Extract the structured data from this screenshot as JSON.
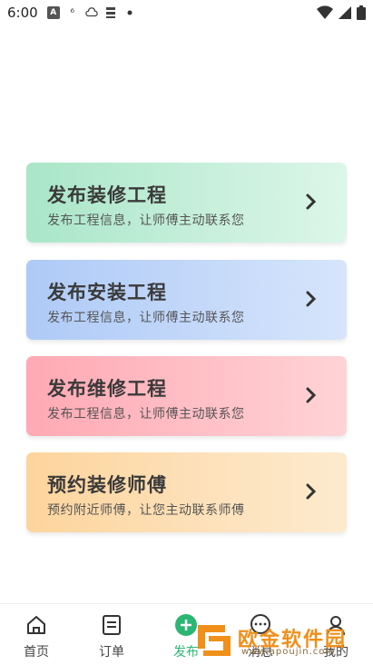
{
  "status_bar": {
    "time": "6:00",
    "icons": [
      "a-box-icon",
      "rotate-icon",
      "cloud-icon",
      "storage-icon",
      "dot-icon"
    ],
    "right_icons": [
      "wifi-icon",
      "signal-icon",
      "battery-icon"
    ]
  },
  "cards": [
    {
      "title": "发布装修工程",
      "subtitle": "发布工程信息，让师傅主动联系您",
      "color": "#b9ebd2"
    },
    {
      "title": "发布安装工程",
      "subtitle": "发布工程信息，让师傅主动联系您",
      "color": "#bcd3f8"
    },
    {
      "title": "发布维修工程",
      "subtitle": "发布工程信息，让师傅主动联系您",
      "color": "#ffb8c0"
    },
    {
      "title": "预约装修师傅",
      "subtitle": "预约附近师傅，让您主动联系师傅",
      "color": "#fddbb0"
    }
  ],
  "tab_bar": {
    "items": [
      {
        "label": "首页",
        "icon": "home-icon"
      },
      {
        "label": "订单",
        "icon": "order-icon"
      },
      {
        "label": "发布",
        "icon": "plus-circle-icon",
        "active": true
      },
      {
        "label": "消息",
        "icon": "chat-icon"
      },
      {
        "label": "我的",
        "icon": "user-icon"
      }
    ],
    "active_color": "#2bb673"
  },
  "watermark": {
    "text": "欧金软件园",
    "url": "www.apoujin.com"
  }
}
